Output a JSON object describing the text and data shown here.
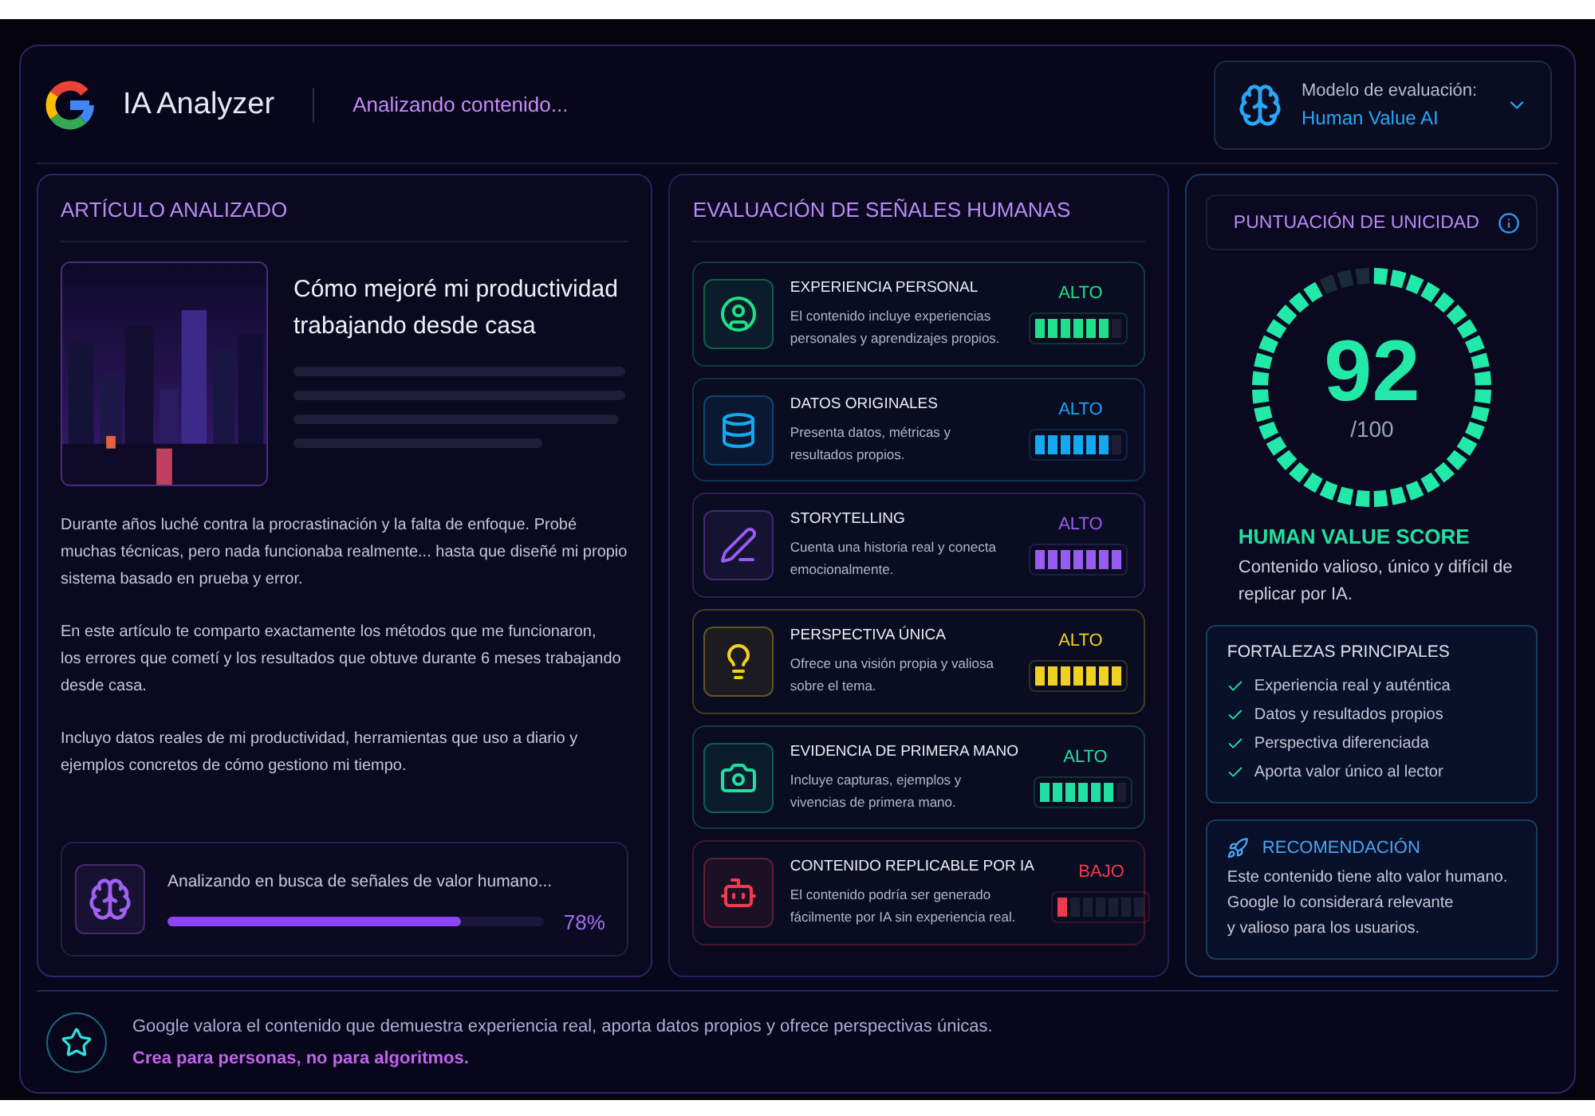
{
  "header": {
    "app_name": "IA Analyzer",
    "status": "Analizando contenido...",
    "model_selector": {
      "label": "Modelo de evaluación:",
      "value": "Human Value AI"
    }
  },
  "article_panel": {
    "title": "ARTÍCULO ANALIZADO",
    "article_title": "Cómo mejoré mi productividad trabajando desde casa",
    "paragraphs": [
      "Durante años luché contra la procrastinación y la falta de enfoque. Probé muchas técnicas, pero nada funcionaba realmente... hasta que diseñé mi propio sistema basado en prueba y error.",
      "En este artículo te comparto exactamente los métodos que me funcionaron,\nlos errores que cometí y los resultados que obtuve durante 6 meses trabajando desde casa.",
      "Incluyo datos reales de mi productividad, herramientas que uso a diario y ejemplos concretos de cómo gestiono mi tiempo."
    ],
    "analysis": {
      "text": "Analizando en busca de señales de valor humano...",
      "level": 0.78,
      "reading": "78%"
    }
  },
  "signals_panel": {
    "title": "EVALUACIÓN DE SEÑALES HUMANAS",
    "signals": [
      {
        "name": "EXPERIENCIA PERSONAL",
        "description": "El contenido incluye experiencias personales y aprendizajes propios.",
        "rating": "ALTO",
        "level": 0.86,
        "color": "#1fe08a"
      },
      {
        "name": "DATOS ORIGINALES",
        "description": "Presenta datos, métricas y resultados propios.",
        "rating": "ALTO",
        "level": 0.86,
        "color": "#14a8f0"
      },
      {
        "name": "STORYTELLING",
        "description": "Cuenta una historia real y conecta emocionalmente.",
        "rating": "ALTO",
        "level": 1,
        "color": "#9a5cf0"
      },
      {
        "name": "PERSPECTIVA ÚNICA",
        "description": "Ofrece una visión propia y valiosa sobre el tema.",
        "rating": "ALTO",
        "level": 1,
        "color": "#f0d020"
      },
      {
        "name": "EVIDENCIA DE PRIMERA MANO",
        "description": "Incluye capturas, ejemplos y vivencias de primera mano.",
        "rating": "ALTO",
        "level": 0.86,
        "color": "#1fe0a0"
      },
      {
        "name": "CONTENIDO REPLICABLE POR IA",
        "description": "El contenido podría ser generado fácilmente por IA sin experiencia real.",
        "rating": "BAJO",
        "level": 0.14,
        "color": "#f03a50"
      }
    ]
  },
  "score_panel": {
    "title": "PUNTUACIÓN DE UNICIDAD",
    "score": "92",
    "max": "/100",
    "level": 0.92,
    "score_label": "HUMAN VALUE SCORE",
    "summary": "Contenido valioso, único y difícil de replicar por IA.",
    "strengths": {
      "title": "FORTALEZAS PRINCIPALES",
      "items": [
        "Experiencia real y auténtica",
        "Datos y resultados propios",
        "Perspectiva diferenciada",
        "Aporta valor único al lector"
      ]
    },
    "recommendation": {
      "title": "RECOMENDACIÓN",
      "text": "Este contenido tiene alto valor humano.\nGoogle lo considerará relevante\ny valioso para los usuarios."
    }
  },
  "footer": {
    "text": "Google valora el contenido que demuestra experiencia real, aporta datos propios y ofrece perspectivas únicas.",
    "motto": "Crea para personas, no para algoritmos."
  }
}
